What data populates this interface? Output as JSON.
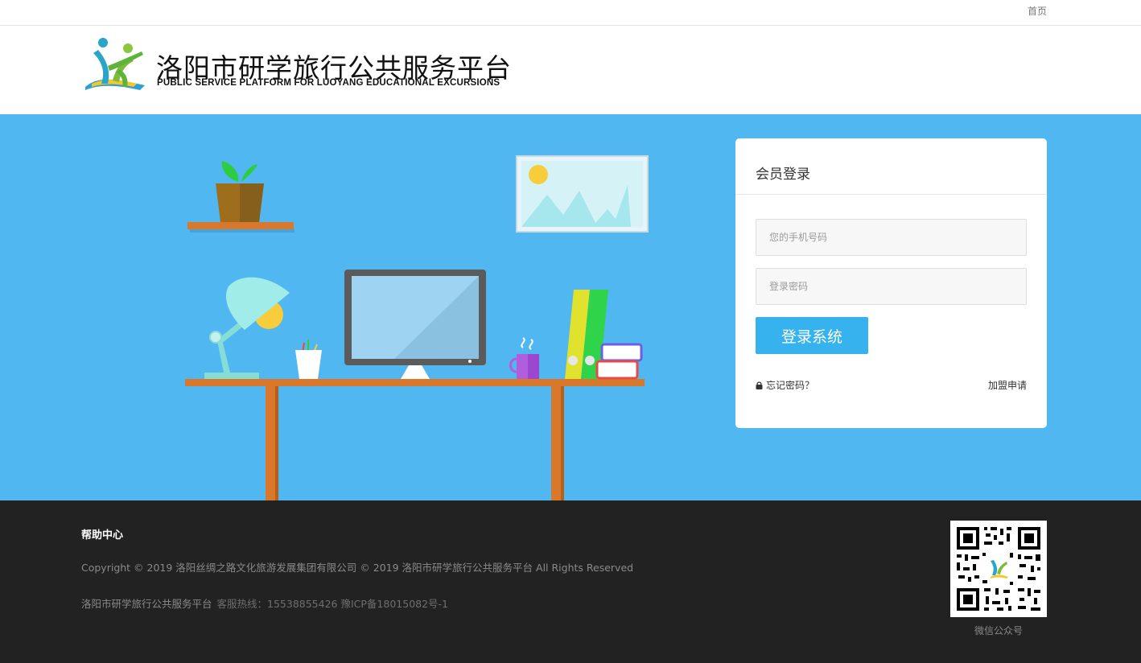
{
  "topbar": {
    "home_label": "首页"
  },
  "header": {
    "title": "洛阳市研学旅行公共服务平台",
    "subtitle": "PUBLIC SERVICE PLATFORM FOR LUOYANG EDUCATIONAL EXCURSIONS"
  },
  "login": {
    "title": "会员登录",
    "phone_placeholder": "您的手机号码",
    "password_placeholder": "登录密码",
    "submit_label": "登录系统",
    "forgot_label": "忘记密码？",
    "join_label": "加盟申请"
  },
  "footer": {
    "help_label": "帮助中心",
    "copyright": "Copyright © 2019 洛阳丝绸之路文化旅游发展集团有限公司 © 2019 洛阳市研学旅行公共服务平台 All Rights Reserved",
    "site_name": "洛阳市研学旅行公共服务平台",
    "hotline": "客服热线：15538855426 豫ICP备18015082号-1",
    "qr_caption": "微信公众号"
  },
  "colors": {
    "hero_bg": "#51b7f0",
    "button": "#36b2ee",
    "footer_bg": "#222222"
  }
}
